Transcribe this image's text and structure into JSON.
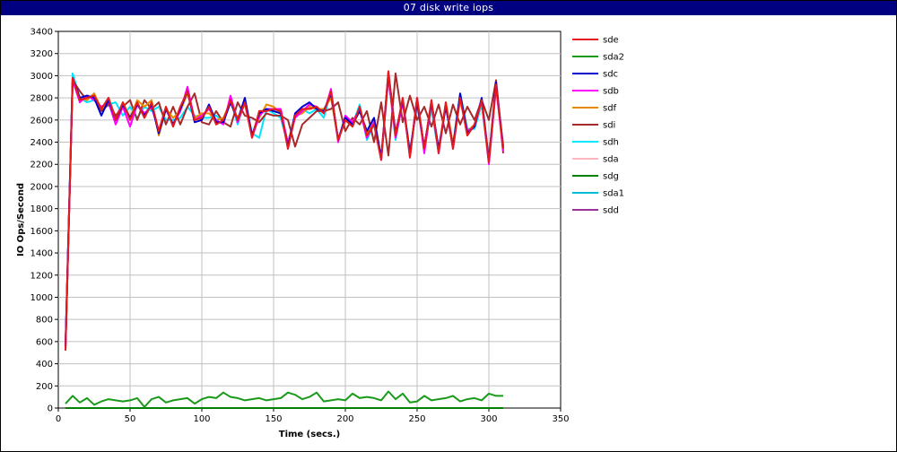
{
  "window": {
    "title": "07 disk write iops"
  },
  "chart_data": {
    "type": "line",
    "title": "07 disk write iops",
    "xlabel": "Time (secs.)",
    "ylabel": "IO Ops/Second",
    "xlim": [
      0,
      350
    ],
    "ylim": [
      0,
      3400
    ],
    "xticks": [
      0,
      50,
      100,
      150,
      200,
      250,
      300,
      350
    ],
    "yticks": [
      0,
      200,
      400,
      600,
      800,
      1000,
      1200,
      1400,
      1600,
      1800,
      2000,
      2200,
      2400,
      2600,
      2800,
      3000,
      3200,
      3400
    ],
    "grid": true,
    "legend_position": "right",
    "x": [
      5,
      10,
      15,
      20,
      25,
      30,
      35,
      40,
      45,
      50,
      55,
      60,
      65,
      70,
      75,
      80,
      85,
      90,
      95,
      100,
      105,
      110,
      115,
      120,
      125,
      130,
      135,
      140,
      145,
      150,
      155,
      160,
      165,
      170,
      175,
      180,
      185,
      190,
      195,
      200,
      205,
      210,
      215,
      220,
      225,
      230,
      235,
      240,
      245,
      250,
      255,
      260,
      265,
      270,
      275,
      280,
      285,
      290,
      295,
      300,
      305,
      310
    ],
    "series": [
      {
        "name": "sde",
        "color": "#e41a1c",
        "values": [
          520,
          2980,
          2780,
          2800,
          2820,
          2700,
          2800,
          2600,
          2760,
          2600,
          2760,
          2620,
          2760,
          2500,
          2720,
          2540,
          2720,
          2860,
          2600,
          2620,
          2720,
          2560,
          2600,
          2780,
          2600,
          2760,
          2440,
          2680,
          2680,
          2700,
          2680,
          2340,
          2640,
          2700,
          2700,
          2720,
          2660,
          2860,
          2420,
          2600,
          2540,
          2720,
          2460,
          2560,
          2240,
          3040,
          2460,
          2800,
          2260,
          2800,
          2340,
          2780,
          2300,
          2760,
          2340,
          2800,
          2460,
          2560,
          2780,
          2220,
          2920,
          2340
        ]
      },
      {
        "name": "sda2",
        "color": "#1a9a1a",
        "values": [
          40,
          110,
          50,
          90,
          30,
          60,
          80,
          70,
          60,
          70,
          90,
          10,
          80,
          100,
          50,
          70,
          80,
          90,
          40,
          80,
          100,
          90,
          140,
          100,
          90,
          70,
          80,
          90,
          70,
          80,
          90,
          140,
          120,
          80,
          100,
          140,
          60,
          70,
          80,
          70,
          130,
          90,
          100,
          90,
          70,
          150,
          80,
          130,
          50,
          60,
          110,
          70,
          80,
          90,
          110,
          60,
          80,
          90,
          70,
          130,
          110,
          110
        ]
      },
      {
        "name": "sdc",
        "color": "#0000cc",
        "values": [
          560,
          2980,
          2800,
          2820,
          2800,
          2640,
          2780,
          2600,
          2740,
          2620,
          2740,
          2640,
          2740,
          2480,
          2700,
          2560,
          2700,
          2860,
          2580,
          2600,
          2740,
          2580,
          2580,
          2760,
          2600,
          2800,
          2460,
          2660,
          2700,
          2680,
          2660,
          2360,
          2660,
          2720,
          2760,
          2700,
          2680,
          2840,
          2420,
          2620,
          2560,
          2680,
          2500,
          2620,
          2260,
          3020,
          2480,
          2780,
          2300,
          2760,
          2360,
          2760,
          2340,
          2720,
          2360,
          2840,
          2480,
          2540,
          2800,
          2240,
          2940,
          2360
        ]
      },
      {
        "name": "sdb",
        "color": "#ff00ff",
        "values": [
          540,
          2960,
          2760,
          2820,
          2780,
          2720,
          2760,
          2560,
          2720,
          2540,
          2740,
          2660,
          2720,
          2500,
          2700,
          2560,
          2680,
          2900,
          2600,
          2640,
          2700,
          2600,
          2560,
          2820,
          2580,
          2760,
          2440,
          2640,
          2700,
          2700,
          2700,
          2380,
          2620,
          2680,
          2740,
          2720,
          2660,
          2880,
          2400,
          2640,
          2580,
          2700,
          2440,
          2580,
          2240,
          3000,
          2440,
          2760,
          2280,
          2800,
          2300,
          2760,
          2300,
          2740,
          2340,
          2820,
          2500,
          2540,
          2780,
          2200,
          2900,
          2320
        ]
      },
      {
        "name": "sdf",
        "color": "#e88a00",
        "values": [
          540,
          2960,
          2800,
          2780,
          2840,
          2700,
          2760,
          2600,
          2760,
          2620,
          2780,
          2720,
          2780,
          2460,
          2700,
          2620,
          2680,
          2840,
          2620,
          2660,
          2660,
          2600,
          2620,
          2760,
          2620,
          2740,
          2460,
          2620,
          2740,
          2720,
          2660,
          2400,
          2640,
          2660,
          2720,
          2700,
          2700,
          2800,
          2420,
          2600,
          2540,
          2700,
          2480,
          2580,
          2260,
          2980,
          2480,
          2760,
          2300,
          2760,
          2340,
          2740,
          2320,
          2760,
          2380,
          2780,
          2500,
          2560,
          2760,
          2240,
          2900,
          2360
        ]
      },
      {
        "name": "sdi",
        "color": "#a52a2a",
        "values": [
          520,
          2960,
          2860,
          2780,
          2840,
          2680,
          2740,
          2640,
          2720,
          2780,
          2600,
          2780,
          2700,
          2760,
          2560,
          2720,
          2560,
          2720,
          2840,
          2580,
          2560,
          2680,
          2580,
          2540,
          2760,
          2640,
          2620,
          2580,
          2660,
          2640,
          2640,
          2600,
          2360,
          2560,
          2620,
          2680,
          2680,
          2700,
          2760,
          2500,
          2620,
          2560,
          2680,
          2400,
          2760,
          2280,
          3020,
          2580,
          2820,
          2600,
          2720,
          2540,
          2740,
          2480,
          2740,
          2560,
          2720,
          2600,
          2780,
          2600,
          2960,
          2300
        ]
      },
      {
        "name": "sdh",
        "color": "#00e5ff",
        "values": [
          540,
          3020,
          2800,
          2760,
          2780,
          2700,
          2740,
          2760,
          2640,
          2720,
          2620,
          2720,
          2680,
          2720,
          2600,
          2600,
          2620,
          2720,
          2640,
          2620,
          2620,
          2640,
          2580,
          2780,
          2560,
          2780,
          2480,
          2440,
          2700,
          2660,
          2620,
          2380,
          2640,
          2700,
          2660,
          2700,
          2620,
          2860,
          2420,
          2640,
          2560,
          2740,
          2420,
          2560,
          2260,
          2980,
          2420,
          2780,
          2320,
          2740,
          2340,
          2700,
          2300,
          2740,
          2380,
          2840,
          2520,
          2520,
          2740,
          2220,
          2900,
          2340
        ]
      },
      {
        "name": "sda",
        "color": "#ffb6c1",
        "values": [
          540,
          2960,
          2780,
          2800,
          2820,
          2700,
          2800,
          2600,
          2760,
          2600,
          2760,
          2620,
          2760,
          2500,
          2720,
          2540,
          2720,
          2860,
          2600,
          2620,
          2720,
          2560,
          2600,
          2780,
          2600,
          2760,
          2440,
          2680,
          2680,
          2700,
          2680,
          2340,
          2640,
          2700,
          2700,
          2720,
          2660,
          2860,
          2420,
          2600,
          2540,
          2720,
          2460,
          2560,
          2240,
          3040,
          2460,
          2800,
          2260,
          2800,
          2340,
          2780,
          2300,
          2760,
          2340,
          2800,
          2460,
          2560,
          2780,
          2220,
          2920,
          2340
        ]
      },
      {
        "name": "sdg",
        "color": "#008000",
        "values": [
          0,
          0,
          0,
          0,
          0,
          0,
          0,
          0,
          0,
          0,
          0,
          0,
          0,
          0,
          0,
          0,
          0,
          0,
          0,
          0,
          0,
          0,
          0,
          0,
          0,
          0,
          0,
          0,
          0,
          0,
          0,
          0,
          0,
          0,
          0,
          0,
          0,
          0,
          0,
          0,
          0,
          0,
          0,
          0,
          0,
          0,
          0,
          0,
          0,
          0,
          0,
          0,
          0,
          0,
          0,
          0,
          0,
          0,
          0,
          0,
          0,
          0
        ]
      },
      {
        "name": "sda1",
        "color": "#00bcd4",
        "values": [
          0,
          0,
          0,
          0,
          0,
          0,
          0,
          0,
          0,
          0,
          0,
          0,
          0,
          0,
          0,
          0,
          0,
          0,
          0,
          0,
          0,
          0,
          0,
          0,
          0,
          0,
          0,
          0,
          0,
          0,
          0,
          0,
          0,
          0,
          0,
          0,
          0,
          0,
          0,
          0,
          0,
          0,
          0,
          0,
          0,
          0,
          0,
          0,
          0,
          0,
          0,
          0,
          0,
          0,
          0,
          0,
          0,
          0,
          0,
          0,
          0,
          0
        ]
      },
      {
        "name": "sdd",
        "color": "#993399",
        "values": [
          560,
          2980,
          2780,
          2800,
          2820,
          2700,
          2800,
          2620,
          2760,
          2600,
          2760,
          2620,
          2740,
          2500,
          2720,
          2540,
          2720,
          2860,
          2600,
          2620,
          2720,
          2560,
          2600,
          2780,
          2600,
          2760,
          2440,
          2680,
          2680,
          2700,
          2680,
          2340,
          2640,
          2700,
          2700,
          2720,
          2660,
          2860,
          2420,
          2600,
          2540,
          2720,
          2460,
          2560,
          2240,
          3040,
          2460,
          2800,
          2260,
          2800,
          2340,
          2780,
          2300,
          2760,
          2340,
          2800,
          2460,
          2560,
          2780,
          2220,
          2920,
          2340
        ]
      }
    ]
  }
}
